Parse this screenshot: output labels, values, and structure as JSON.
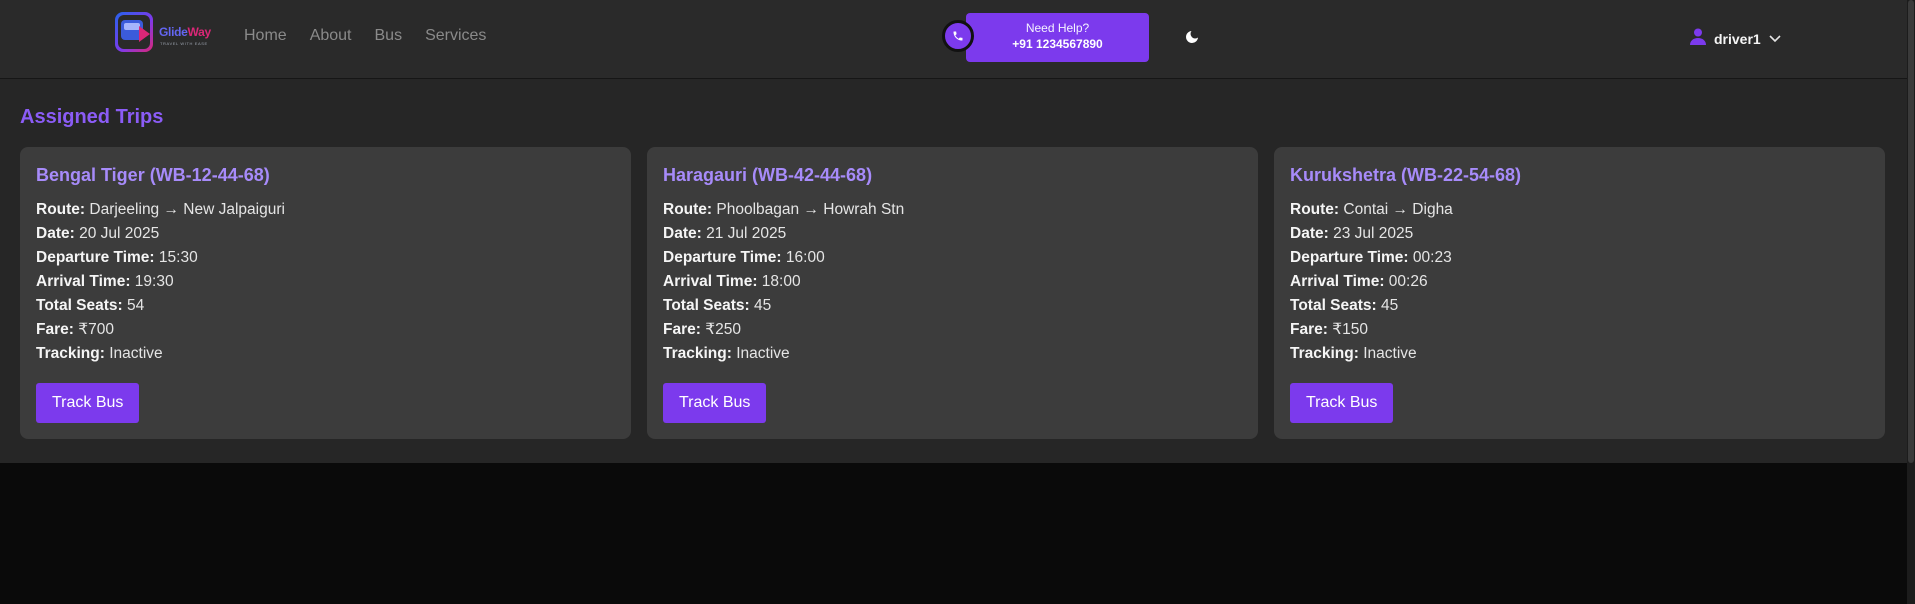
{
  "brand": {
    "name_part1": "Glide",
    "name_part2": "Way",
    "tagline": "TRAVEL WITH EASE"
  },
  "nav": {
    "items": [
      {
        "label": "Home"
      },
      {
        "label": "About"
      },
      {
        "label": "Bus"
      },
      {
        "label": "Services"
      }
    ]
  },
  "help": {
    "title": "Need Help?",
    "phone": "+91 1234567890"
  },
  "theme_toggle": {
    "icon": "moon-icon"
  },
  "user": {
    "name": "driver1",
    "icon": "user-icon"
  },
  "main": {
    "title": "Assigned Trips"
  },
  "labels": {
    "route": "Route:",
    "date": "Date:",
    "departure": "Departure Time:",
    "arrival": "Arrival Time:",
    "seats": "Total Seats:",
    "fare": "Fare:",
    "tracking": "Tracking:"
  },
  "trips": [
    {
      "title": "Bengal Tiger (WB-12-44-68)",
      "route": "Darjeeling → New Jalpaiguri",
      "date": "20 Jul 2025",
      "departure": "15:30",
      "arrival": "19:30",
      "seats": "54",
      "fare": "₹700",
      "tracking": "Inactive",
      "button": "Track Bus"
    },
    {
      "title": "Haragauri (WB-42-44-68)",
      "route": "Phoolbagan → Howrah Stn",
      "date": "21 Jul 2025",
      "departure": "16:00",
      "arrival": "18:00",
      "seats": "45",
      "fare": "₹250",
      "tracking": "Inactive",
      "button": "Track Bus"
    },
    {
      "title": "Kurukshetra (WB-22-54-68)",
      "route": "Contai → Digha",
      "date": "23 Jul 2025",
      "departure": "00:23",
      "arrival": "00:26",
      "seats": "45",
      "fare": "₹150",
      "tracking": "Inactive",
      "button": "Track Bus"
    }
  ],
  "colors": {
    "accent": "#7c3aed",
    "card_title": "#a78bfa",
    "background": "#262626"
  }
}
